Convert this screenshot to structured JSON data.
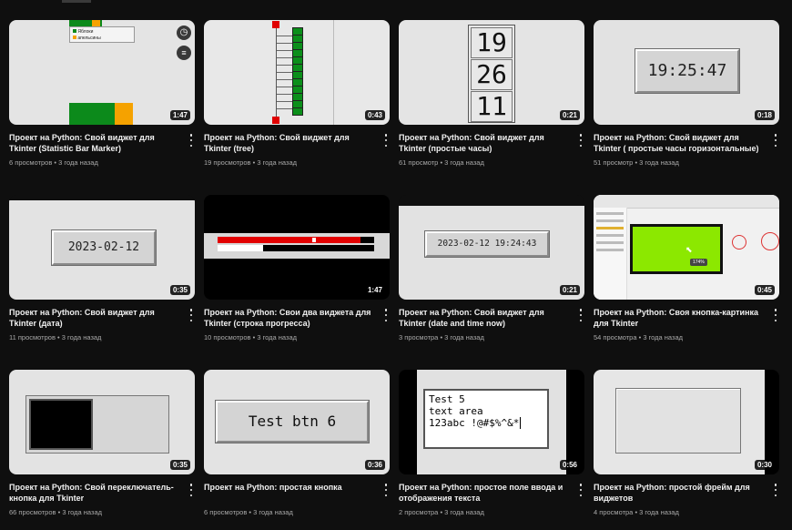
{
  "videos": [
    {
      "title": "Проект на Python: Свой виджет для Tkinter (Statistic Bar Marker)",
      "views": "6 просмотров",
      "age": "3 года назад",
      "duration": "1:47",
      "thumb": {
        "legend": [
          "Яблоки",
          "апельсины"
        ]
      }
    },
    {
      "title": "Проект на Python: Свой виджет для Tkinter (tree)",
      "views": "19 просмотров",
      "age": "3 года назад",
      "duration": "0:43"
    },
    {
      "title": "Проект на Python: Свой виджет для Tkinter (простые часы)",
      "views": "61 просмотр",
      "age": "3 года назад",
      "duration": "0:21",
      "thumb": {
        "digits": [
          "19",
          "26",
          "11"
        ]
      }
    },
    {
      "title": "Проект на Python: Свой виджет для Tkinter ( простые часы горизонтальные)",
      "views": "51 просмотр",
      "age": "3 года назад",
      "duration": "0:18",
      "thumb": {
        "time": "19:25:47"
      }
    },
    {
      "title": "Проект на Python: Свой виджет для Tkinter (дата)",
      "views": "11 просмотров",
      "age": "3 года назад",
      "duration": "0:35",
      "thumb": {
        "date": "2023-02-12"
      }
    },
    {
      "title": "Проект на Python: Свои два виджета для Tkinter (строка прогресса)",
      "views": "10 просмотров",
      "age": "3 года назад",
      "duration": "1:47",
      "thumb": {
        "progress_red": 0.91,
        "progress_white": 0.29
      }
    },
    {
      "title": "Проект на Python: Свой виджет для Tkinter (date and time now)",
      "views": "3 просмотра",
      "age": "3 года назад",
      "duration": "0:21",
      "thumb": {
        "datetime": "2023-02-12 19:24:43"
      }
    },
    {
      "title": "Проект на Python: Своя кнопка-картинка для Tkinter",
      "views": "54 просмотра",
      "age": "3 года назад",
      "duration": "0:45",
      "thumb": {
        "zoom": "174%"
      }
    },
    {
      "title": "Проект на Python: Свой переключатель-кнопка для Tkinter",
      "views": "66 просмотров",
      "age": "3 года назад",
      "duration": "0:35"
    },
    {
      "title": "Проект на Python: простая кнопка",
      "views": "6 просмотров",
      "age": "3 года назад",
      "duration": "0:36",
      "thumb": {
        "button": "Test btn 6"
      }
    },
    {
      "title": "Проект на Python: простое поле ввода и отображения текста",
      "views": "2 просмотра",
      "age": "3 года назад",
      "duration": "0:56",
      "thumb": {
        "lines": [
          "Test 5",
          "text area",
          "123abc !@#$%^&*"
        ]
      }
    },
    {
      "title": "Проект на Python: простой фрейм для виджетов",
      "views": "4 просмотра",
      "age": "3 года назад",
      "duration": "0:30"
    }
  ],
  "separator": " • "
}
